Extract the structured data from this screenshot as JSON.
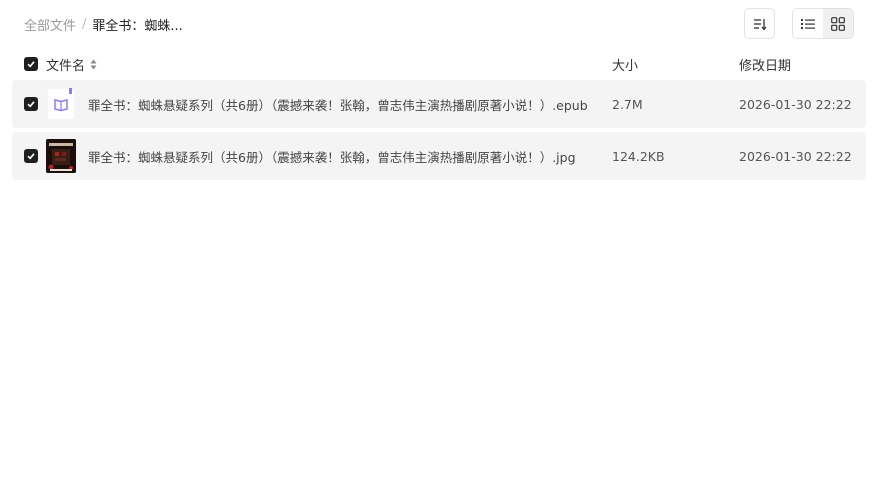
{
  "breadcrumb": {
    "root": "全部文件",
    "separator": "/",
    "current": "罪全书：蜘蛛..."
  },
  "toolbar": {
    "sort_icon": "sort-list-icon",
    "list_view_icon": "list-view-icon",
    "grid_view_icon": "grid-view-icon"
  },
  "table": {
    "columns": {
      "name": "文件名",
      "size": "大小",
      "date": "修改日期"
    },
    "rows": [
      {
        "name": "罪全书：蜘蛛悬疑系列（共6册）（震撼来袭！张翰，曾志伟主演热播剧原著小说！）.epub",
        "size": "2.7M",
        "date": "2026-01-30 22:22",
        "icon": "epub-book-icon",
        "checked": true
      },
      {
        "name": "罪全书：蜘蛛悬疑系列（共6册）（震撼来袭！张翰，曾志伟主演热播剧原著小说！）.jpg",
        "size": "124.2KB",
        "date": "2026-01-30 22:22",
        "icon": "image-thumbnail",
        "checked": true
      }
    ]
  },
  "colors": {
    "row_bg": "#f4f4f5",
    "checkbox": "#1f1f1f",
    "epub_accent": "#8b7cf6"
  }
}
